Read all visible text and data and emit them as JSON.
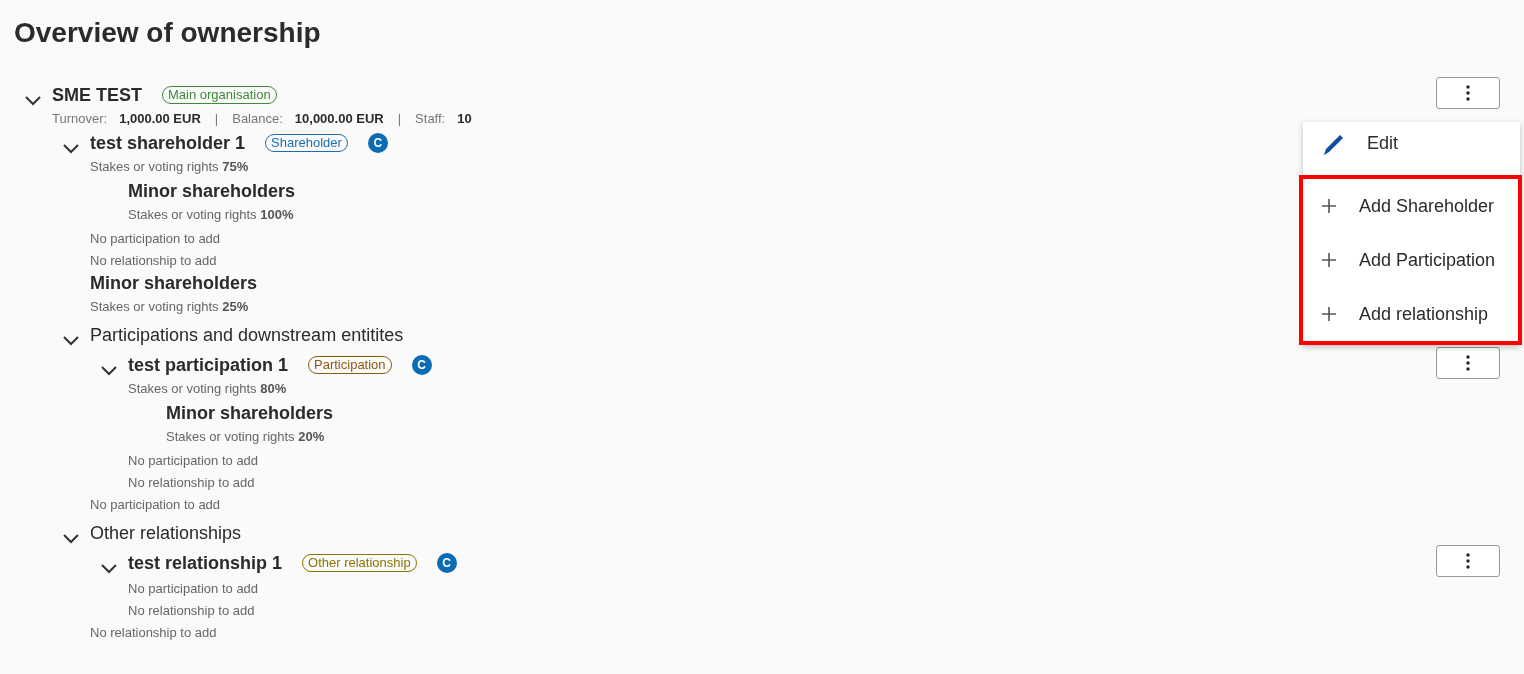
{
  "title": "Overview of ownership",
  "tree": [
    {
      "kind": "entity",
      "expanded": true,
      "title": "SME TEST",
      "badge": {
        "label": "Main organisation",
        "color": "#3d8b37"
      },
      "metrics": [
        {
          "label": "Turnover:",
          "value": "1,000.00 EUR"
        },
        {
          "separator": "|",
          "label": "Balance:",
          "value": "10,000.00 EUR"
        },
        {
          "separator": "|",
          "label": "Staff:",
          "value": "10"
        }
      ],
      "menu_button": true,
      "children": [
        {
          "kind": "entity",
          "expanded": true,
          "title": "test shareholder 1",
          "badge": {
            "label": "Shareholder",
            "color": "#1a6fb5"
          },
          "tag": "C",
          "stake": {
            "label": "Stakes or voting rights",
            "value": "75%"
          },
          "children": [
            {
              "kind": "group",
              "title": "Minor shareholders",
              "stake": {
                "label": "Stakes or voting rights",
                "value": "100%"
              }
            }
          ],
          "notes": [
            "No participation to add",
            "No relationship to add"
          ]
        },
        {
          "kind": "group",
          "title": "Minor shareholders",
          "stake": {
            "label": "Stakes or voting rights",
            "value": "25%"
          }
        },
        {
          "kind": "section",
          "expanded": true,
          "title": "Participations and downstream entitites",
          "children": [
            {
              "kind": "entity",
              "expanded": true,
              "title": "test participation 1",
              "badge": {
                "label": "Participation",
                "color": "#8a5a14"
              },
              "tag": "C",
              "stake": {
                "label": "Stakes or voting rights",
                "value": "80%"
              },
              "menu_button": true,
              "children": [
                {
                  "kind": "group",
                  "title": "Minor shareholders",
                  "stake": {
                    "label": "Stakes or voting rights",
                    "value": "20%"
                  }
                }
              ],
              "notes": [
                "No participation to add",
                "No relationship to add"
              ]
            }
          ],
          "notes": [
            "No participation to add"
          ]
        },
        {
          "kind": "section",
          "expanded": true,
          "title": "Other relationships",
          "children": [
            {
              "kind": "entity",
              "expanded": true,
              "title": "test relationship 1",
              "badge": {
                "label": "Other relationship",
                "color": "#8a7400"
              },
              "tag": "C",
              "menu_button": true,
              "notes": [
                "No participation to add",
                "No relationship to add"
              ]
            }
          ],
          "notes": [
            "No relationship to add"
          ]
        }
      ]
    }
  ],
  "menu": {
    "items": [
      {
        "kind": "edit",
        "label": "Edit",
        "highlighted": false
      },
      {
        "kind": "add",
        "label": "Add Shareholder",
        "highlighted": true
      },
      {
        "kind": "add",
        "label": "Add Participation",
        "highlighted": true
      },
      {
        "kind": "add",
        "label": "Add relationship",
        "highlighted": true
      }
    ]
  }
}
